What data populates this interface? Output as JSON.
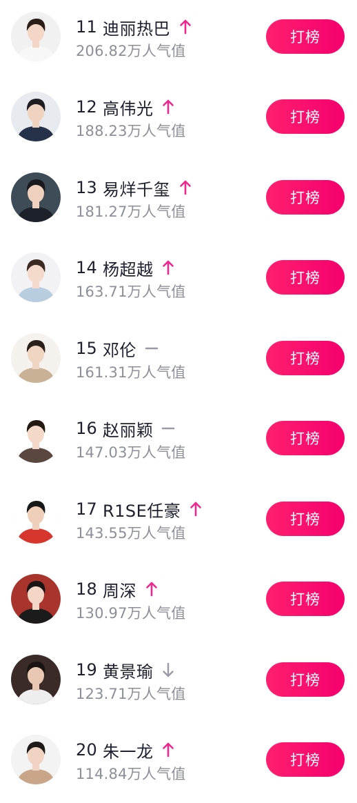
{
  "rows": [
    {
      "rank": "11",
      "name": "迪丽热巴",
      "trend": "up",
      "popularity": "206.82万人气值",
      "button": "打榜"
    },
    {
      "rank": "12",
      "name": "高伟光",
      "trend": "up",
      "popularity": "188.23万人气值",
      "button": "打榜"
    },
    {
      "rank": "13",
      "name": "易烊千玺",
      "trend": "up",
      "popularity": "181.27万人气值",
      "button": "打榜"
    },
    {
      "rank": "14",
      "name": "杨超越",
      "trend": "up",
      "popularity": "163.71万人气值",
      "button": "打榜"
    },
    {
      "rank": "15",
      "name": "邓伦",
      "trend": "same",
      "popularity": "161.31万人气值",
      "button": "打榜"
    },
    {
      "rank": "16",
      "name": "赵丽颖",
      "trend": "same",
      "popularity": "147.03万人气值",
      "button": "打榜"
    },
    {
      "rank": "17",
      "name": "R1SE任豪",
      "trend": "up",
      "popularity": "143.55万人气值",
      "button": "打榜"
    },
    {
      "rank": "18",
      "name": "周深",
      "trend": "up",
      "popularity": "130.97万人气值",
      "button": "打榜"
    },
    {
      "rank": "19",
      "name": "黄景瑜",
      "trend": "down",
      "popularity": "123.71万人气值",
      "button": "打榜"
    },
    {
      "rank": "20",
      "name": "朱一龙",
      "trend": "up",
      "popularity": "114.84万人气值",
      "button": "打榜"
    }
  ],
  "colors": {
    "button_accent": "#ff1f6f",
    "trend_up": "#f0268f",
    "trend_neutral": "#9a9aa6",
    "popularity_text": "#8e8e98"
  },
  "icons": {
    "up": "arrow-up-icon",
    "down": "arrow-down-icon",
    "same": "dash-icon"
  }
}
